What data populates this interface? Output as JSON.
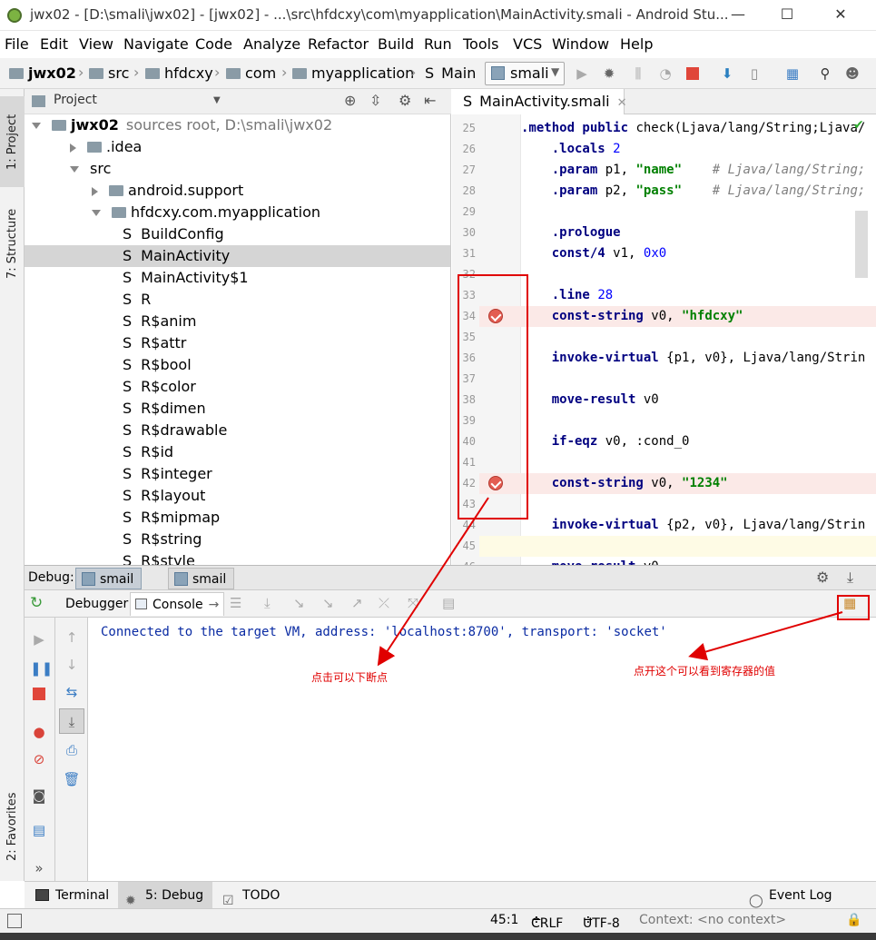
{
  "window": {
    "title": "jwx02 - [D:\\smali\\jwx02] - [jwx02] - ...\\src\\hfdcxy\\com\\myapplication\\MainActivity.smali - Android Stu...",
    "minimize": "—",
    "maximize": "☐",
    "close": "✕"
  },
  "menu": [
    "File",
    "Edit",
    "View",
    "Navigate",
    "Code",
    "Analyze",
    "Refactor",
    "Build",
    "Run",
    "Tools",
    "VCS",
    "Window",
    "Help"
  ],
  "breadcrumbs": [
    "jwx02",
    "src",
    "hfdcxy",
    "com",
    "myapplication",
    "Main"
  ],
  "run_config": "smali",
  "project_panel": {
    "title": "Project",
    "root_label": "jwx02",
    "root_hint": "sources root,  D:\\smali\\jwx02",
    "items": [
      {
        "label": ".idea",
        "type": "folder",
        "arrow": "right"
      },
      {
        "label": "src",
        "type": "none",
        "arrow": "down"
      },
      {
        "label": "android.support",
        "type": "folder",
        "arrow": "right"
      },
      {
        "label": "hfdcxy.com.myapplication",
        "type": "folder",
        "arrow": "down"
      },
      {
        "label": "BuildConfig",
        "type": "smali"
      },
      {
        "label": "MainActivity",
        "type": "smali",
        "selected": true
      },
      {
        "label": "MainActivity$1",
        "type": "smali"
      },
      {
        "label": "R",
        "type": "smali"
      },
      {
        "label": "R$anim",
        "type": "smali"
      },
      {
        "label": "R$attr",
        "type": "smali"
      },
      {
        "label": "R$bool",
        "type": "smali"
      },
      {
        "label": "R$color",
        "type": "smali"
      },
      {
        "label": "R$dimen",
        "type": "smali"
      },
      {
        "label": "R$drawable",
        "type": "smali"
      },
      {
        "label": "R$id",
        "type": "smali"
      },
      {
        "label": "R$integer",
        "type": "smali"
      },
      {
        "label": "R$layout",
        "type": "smali"
      },
      {
        "label": "R$mipmap",
        "type": "smali"
      },
      {
        "label": "R$string",
        "type": "smali"
      },
      {
        "label": "R$style",
        "type": "smali"
      }
    ],
    "smali_prefix": "S"
  },
  "left_strip": {
    "project": "1: Project",
    "structure": "7: Structure",
    "favorites": "2: Favorites"
  },
  "editor": {
    "tab_label": "MainActivity.smali",
    "tab_prefix": "S",
    "line_numbers": [
      "25",
      "26",
      "27",
      "28",
      "29",
      "30",
      "31",
      "32",
      "33",
      "34",
      "35",
      "36",
      "37",
      "38",
      "39",
      "40",
      "41",
      "42",
      "43",
      "44",
      "45",
      "46"
    ],
    "breakpoint_lines": [
      "34",
      "42"
    ],
    "current_line": "45"
  },
  "debug": {
    "label": "Debug:",
    "session_tabs": [
      "smail",
      "smail"
    ],
    "tabs": [
      "Debugger",
      "Console"
    ],
    "console_output": "Connected to the target VM, address: 'localhost:8700', transport: 'socket'"
  },
  "bottom_tabs": [
    "Terminal",
    "5: Debug",
    "TODO"
  ],
  "event_log": "Event Log",
  "status": {
    "position": "45:1",
    "line_sep": "CRLF",
    "encoding": "UTF-8",
    "context": "Context: <no context>"
  },
  "annotations": {
    "breakpoint_note": "点击可以下断点",
    "registers_note": "点开这个可以看到寄存器的值"
  },
  "colors": {
    "accent_red": "#e00000",
    "breakpoint": "#e35d52",
    "keyword": "#000080",
    "string": "#008000"
  }
}
